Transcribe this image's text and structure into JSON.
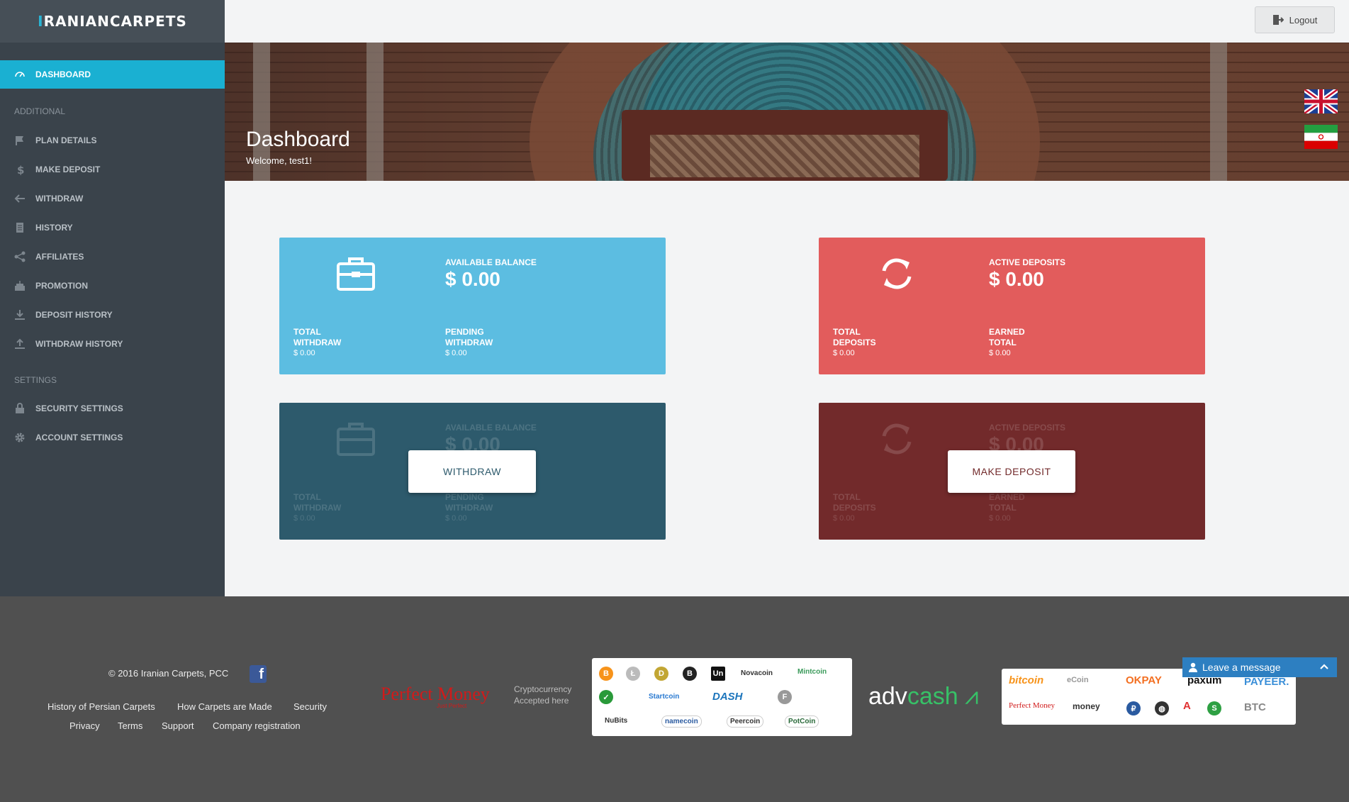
{
  "sidebar": {
    "logo": {
      "accent": "I",
      "rest": "RANIANCARPETS"
    },
    "active": {
      "label": "DASHBOARD",
      "icon": "gauge-icon"
    },
    "section_additional": "ADDITIONAL",
    "additional_items": [
      {
        "label": "PLAN DETAILS",
        "icon": "flag-icon"
      },
      {
        "label": "MAKE DEPOSIT",
        "icon": "dollar-icon"
      },
      {
        "label": "WITHDRAW",
        "icon": "arrow-left-icon"
      },
      {
        "label": "HISTORY",
        "icon": "document-icon"
      },
      {
        "label": "AFFILIATES",
        "icon": "share-icon"
      },
      {
        "label": "PROMOTION",
        "icon": "cake-icon"
      },
      {
        "label": "DEPOSIT HISTORY",
        "icon": "download-icon"
      },
      {
        "label": "WITHDRAW HISTORY",
        "icon": "upload-icon"
      }
    ],
    "section_settings": "SETTINGS",
    "settings_items": [
      {
        "label": "SECURITY SETTINGS",
        "icon": "lock-icon"
      },
      {
        "label": "ACCOUNT SETTINGS",
        "icon": "gear-icon"
      }
    ]
  },
  "topbar": {
    "logout_label": "Logout"
  },
  "banner": {
    "title": "Dashboard",
    "welcome": "Welcome, test1!"
  },
  "cards": {
    "balance": {
      "label": "AVAILABLE BALANCE",
      "value": "$ 0.00",
      "sub1_label_1": "TOTAL",
      "sub1_label_2": "WITHDRAW",
      "sub1_value": "$ 0.00",
      "sub2_label_1": "PENDING",
      "sub2_label_2": "WITHDRAW",
      "sub2_value": "$ 0.00"
    },
    "deposits": {
      "label": "ACTIVE DEPOSITS",
      "value": "$ 0.00",
      "sub1_label_1": "TOTAL",
      "sub1_label_2": "DEPOSITS",
      "sub1_value": "$ 0.00",
      "sub2_label_1": "EARNED",
      "sub2_label_2": "TOTAL",
      "sub2_value": "$ 0.00"
    },
    "withdraw_button": "WITHDRAW",
    "deposit_button": "MAKE DEPOSIT"
  },
  "footer": {
    "copyright": "© 2016 Iranian Carpets, PCC",
    "links_row1": [
      "History of Persian Carpets",
      "How Carpets are Made",
      "Security"
    ],
    "links_row2": [
      "Privacy",
      "Terms",
      "Support",
      "Company registration"
    ],
    "perfect_money": "Perfect Money",
    "perfect_money_sub": "Just Perfect",
    "crypto_line1": "Cryptocurrency",
    "crypto_line2": "Accepted here",
    "coins": [
      "Novacoin",
      "Mintcoin",
      "Startcoin",
      "DASH",
      "NuBits",
      "namecoin",
      "Peercoin",
      "PotCoin"
    ],
    "advcash_a": "adv",
    "advcash_b": "cash",
    "payments": [
      "bitcoin",
      "OKPAY",
      "paxum",
      "PAYEER.",
      "Perfect Money",
      "money",
      "BTC"
    ],
    "leave_message": "Leave a message"
  },
  "colors": {
    "sidebar": "#3a434b",
    "active": "#1ab0d2",
    "card_blue": "#5cbde1",
    "card_red": "#e25c5c",
    "card_dark_blue": "#2d5a6c",
    "card_dark_red": "#722a2b",
    "footer": "#505050"
  }
}
